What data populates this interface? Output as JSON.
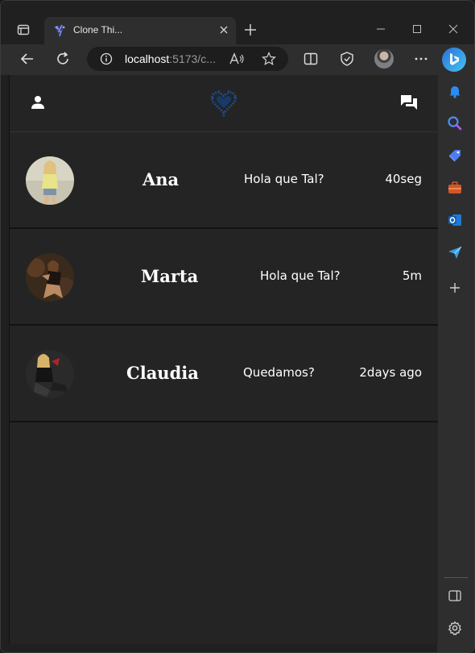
{
  "browser": {
    "tab_title": "Clone Thi...",
    "url_host": "localhost",
    "url_rest": ":5173/c...",
    "read_aloud_label": "Aᵃ"
  },
  "app": {
    "logo": "heart-logo",
    "accent": "#1f4f8a"
  },
  "chats": [
    {
      "name": "Ana",
      "message": "Hola que Tal?",
      "time": "40seg"
    },
    {
      "name": "Marta",
      "message": "Hola que Tal?",
      "time": "5m"
    },
    {
      "name": "Claudia",
      "message": "Quedamos?",
      "time": "2days ago"
    }
  ]
}
